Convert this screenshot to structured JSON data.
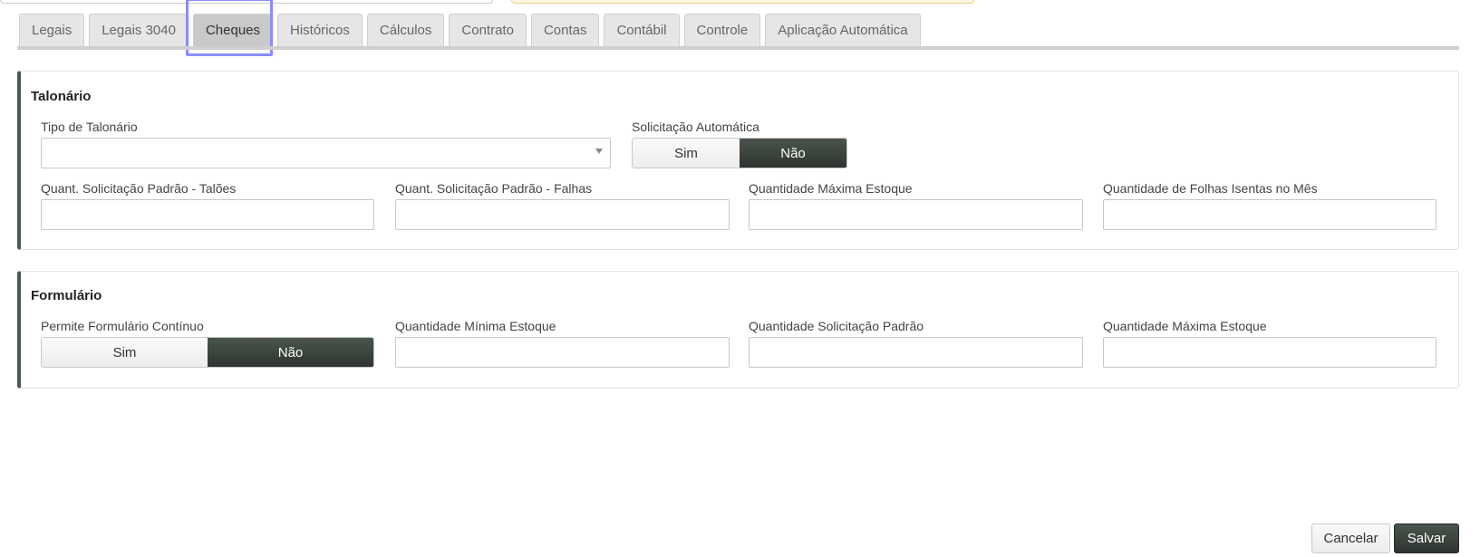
{
  "tabs": [
    "Legais",
    "Legais 3040",
    "Cheques",
    "Históricos",
    "Cálculos",
    "Contrato",
    "Contas",
    "Contábil",
    "Controle",
    "Aplicação Automática"
  ],
  "talonario": {
    "title": "Talonário",
    "tipo_label": "Tipo de Talonário",
    "tipo_value": "",
    "solic_auto_label": "Solicitação Automática",
    "solic_auto_options": [
      "Sim",
      "Não"
    ],
    "solic_auto_selected": "Não",
    "quant_taloes_label": "Quant. Solicitação Padrão - Talões",
    "quant_falhas_label": "Quant. Solicitação Padrão - Falhas",
    "qtd_max_estoque_label": "Quantidade Máxima Estoque",
    "qtd_folhas_isentas_label": "Quantidade de Folhas Isentas no Mês"
  },
  "formulario": {
    "title": "Formulário",
    "permite_label": "Permite Formulário Contínuo",
    "permite_options": [
      "Sim",
      "Não"
    ],
    "permite_selected": "Não",
    "qtd_min_label": "Quantidade Mínima Estoque",
    "qtd_solic_label": "Quantidade Solicitação Padrão",
    "qtd_max_label": "Quantidade Máxima Estoque"
  },
  "actions": {
    "cancel": "Cancelar",
    "save": "Salvar"
  }
}
